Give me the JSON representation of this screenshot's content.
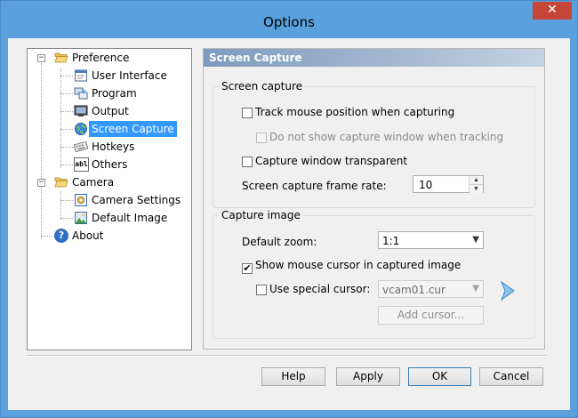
{
  "window": {
    "title": "Options",
    "close_glyph": "✕"
  },
  "tree": [
    {
      "label": "Preference",
      "icon": "folder-open-icon",
      "expander": "−"
    },
    {
      "label": "User Interface",
      "icon": "window-icon"
    },
    {
      "label": "Program",
      "icon": "program-icon"
    },
    {
      "label": "Output",
      "icon": "monitor-icon"
    },
    {
      "label": "Screen Capture",
      "icon": "globe-icon",
      "selected": true
    },
    {
      "label": "Hotkeys",
      "icon": "keyboard-icon"
    },
    {
      "label": "Others",
      "icon": "abl-icon",
      "icon_text": "abl"
    },
    {
      "label": "Camera",
      "icon": "folder-open-icon",
      "expander": "−"
    },
    {
      "label": "Camera Settings",
      "icon": "camera-settings-icon"
    },
    {
      "label": "Default Image",
      "icon": "image-icon"
    },
    {
      "label": "About",
      "icon": "help-icon",
      "icon_text": "?"
    }
  ],
  "panel": {
    "header": "Screen Capture",
    "screen_capture_group": {
      "title": "Screen capture",
      "track_mouse": {
        "label": "Track mouse position when capturing",
        "checked": false
      },
      "no_show_window": {
        "label": "Do not show capture window when tracking",
        "checked": false,
        "disabled": true
      },
      "transparent": {
        "label": "Capture window transparent",
        "checked": false
      },
      "frame_rate": {
        "label": "Screen capture frame rate:",
        "value": "10"
      }
    },
    "capture_image_group": {
      "title": "Capture image",
      "default_zoom": {
        "label": "Default zoom:",
        "value": "1:1"
      },
      "show_cursor": {
        "label": "Show mouse cursor in captured image",
        "checked": true,
        "mark": "✔"
      },
      "special_cursor": {
        "label": "Use special cursor:",
        "checked": false,
        "value": "vcam01.cur"
      },
      "add_cursor": "Add cursor..."
    }
  },
  "buttons": {
    "help": "Help",
    "apply": "Apply",
    "ok": "OK",
    "cancel": "Cancel"
  }
}
